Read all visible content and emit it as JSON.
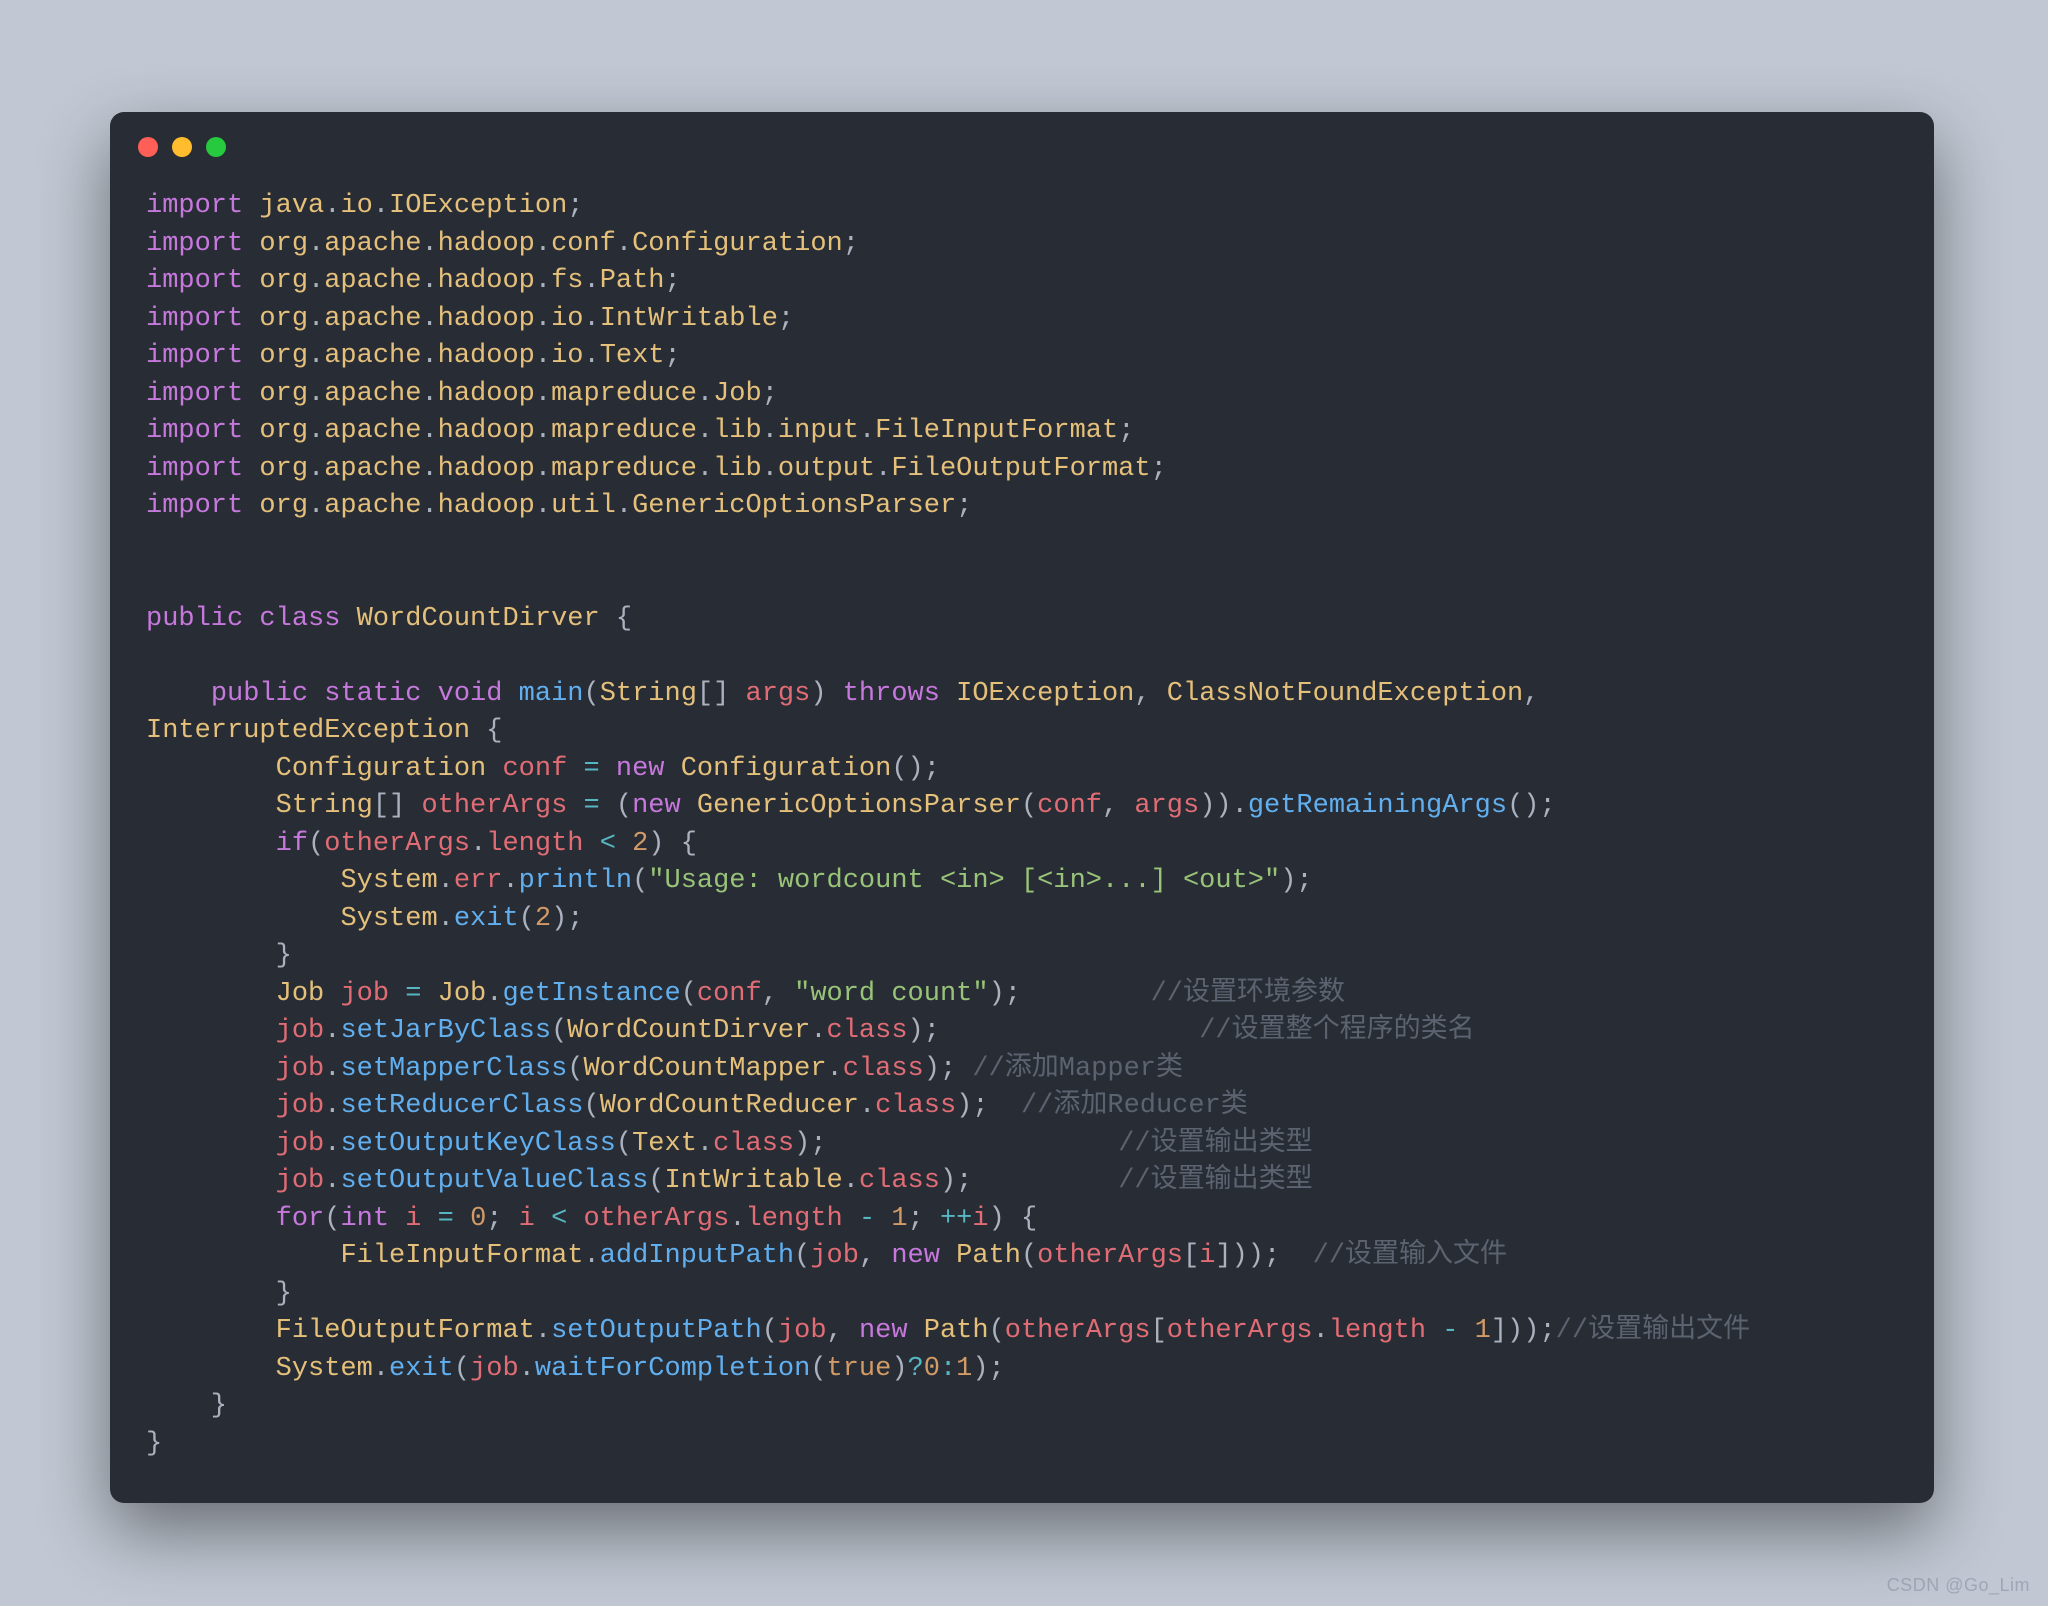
{
  "watermark": "CSDN @Go_Lim",
  "tokens": [
    {
      "c": "kw",
      "t": "import"
    },
    {
      "c": "pun",
      "t": " "
    },
    {
      "c": "pkg",
      "t": "java"
    },
    {
      "c": "pun",
      "t": "."
    },
    {
      "c": "pkg",
      "t": "io"
    },
    {
      "c": "pun",
      "t": "."
    },
    {
      "c": "pkg",
      "t": "IOException"
    },
    {
      "c": "pun",
      "t": ";"
    },
    {
      "nl": true
    },
    {
      "c": "kw",
      "t": "import"
    },
    {
      "c": "pun",
      "t": " "
    },
    {
      "c": "pkg",
      "t": "org"
    },
    {
      "c": "pun",
      "t": "."
    },
    {
      "c": "pkg",
      "t": "apache"
    },
    {
      "c": "pun",
      "t": "."
    },
    {
      "c": "pkg",
      "t": "hadoop"
    },
    {
      "c": "pun",
      "t": "."
    },
    {
      "c": "pkg",
      "t": "conf"
    },
    {
      "c": "pun",
      "t": "."
    },
    {
      "c": "pkg",
      "t": "Configuration"
    },
    {
      "c": "pun",
      "t": ";"
    },
    {
      "nl": true
    },
    {
      "c": "kw",
      "t": "import"
    },
    {
      "c": "pun",
      "t": " "
    },
    {
      "c": "pkg",
      "t": "org"
    },
    {
      "c": "pun",
      "t": "."
    },
    {
      "c": "pkg",
      "t": "apache"
    },
    {
      "c": "pun",
      "t": "."
    },
    {
      "c": "pkg",
      "t": "hadoop"
    },
    {
      "c": "pun",
      "t": "."
    },
    {
      "c": "pkg",
      "t": "fs"
    },
    {
      "c": "pun",
      "t": "."
    },
    {
      "c": "pkg",
      "t": "Path"
    },
    {
      "c": "pun",
      "t": ";"
    },
    {
      "nl": true
    },
    {
      "c": "kw",
      "t": "import"
    },
    {
      "c": "pun",
      "t": " "
    },
    {
      "c": "pkg",
      "t": "org"
    },
    {
      "c": "pun",
      "t": "."
    },
    {
      "c": "pkg",
      "t": "apache"
    },
    {
      "c": "pun",
      "t": "."
    },
    {
      "c": "pkg",
      "t": "hadoop"
    },
    {
      "c": "pun",
      "t": "."
    },
    {
      "c": "pkg",
      "t": "io"
    },
    {
      "c": "pun",
      "t": "."
    },
    {
      "c": "pkg",
      "t": "IntWritable"
    },
    {
      "c": "pun",
      "t": ";"
    },
    {
      "nl": true
    },
    {
      "c": "kw",
      "t": "import"
    },
    {
      "c": "pun",
      "t": " "
    },
    {
      "c": "pkg",
      "t": "org"
    },
    {
      "c": "pun",
      "t": "."
    },
    {
      "c": "pkg",
      "t": "apache"
    },
    {
      "c": "pun",
      "t": "."
    },
    {
      "c": "pkg",
      "t": "hadoop"
    },
    {
      "c": "pun",
      "t": "."
    },
    {
      "c": "pkg",
      "t": "io"
    },
    {
      "c": "pun",
      "t": "."
    },
    {
      "c": "pkg",
      "t": "Text"
    },
    {
      "c": "pun",
      "t": ";"
    },
    {
      "nl": true
    },
    {
      "c": "kw",
      "t": "import"
    },
    {
      "c": "pun",
      "t": " "
    },
    {
      "c": "pkg",
      "t": "org"
    },
    {
      "c": "pun",
      "t": "."
    },
    {
      "c": "pkg",
      "t": "apache"
    },
    {
      "c": "pun",
      "t": "."
    },
    {
      "c": "pkg",
      "t": "hadoop"
    },
    {
      "c": "pun",
      "t": "."
    },
    {
      "c": "pkg",
      "t": "mapreduce"
    },
    {
      "c": "pun",
      "t": "."
    },
    {
      "c": "pkg",
      "t": "Job"
    },
    {
      "c": "pun",
      "t": ";"
    },
    {
      "nl": true
    },
    {
      "c": "kw",
      "t": "import"
    },
    {
      "c": "pun",
      "t": " "
    },
    {
      "c": "pkg",
      "t": "org"
    },
    {
      "c": "pun",
      "t": "."
    },
    {
      "c": "pkg",
      "t": "apache"
    },
    {
      "c": "pun",
      "t": "."
    },
    {
      "c": "pkg",
      "t": "hadoop"
    },
    {
      "c": "pun",
      "t": "."
    },
    {
      "c": "pkg",
      "t": "mapreduce"
    },
    {
      "c": "pun",
      "t": "."
    },
    {
      "c": "pkg",
      "t": "lib"
    },
    {
      "c": "pun",
      "t": "."
    },
    {
      "c": "pkg",
      "t": "input"
    },
    {
      "c": "pun",
      "t": "."
    },
    {
      "c": "pkg",
      "t": "FileInputFormat"
    },
    {
      "c": "pun",
      "t": ";"
    },
    {
      "nl": true
    },
    {
      "c": "kw",
      "t": "import"
    },
    {
      "c": "pun",
      "t": " "
    },
    {
      "c": "pkg",
      "t": "org"
    },
    {
      "c": "pun",
      "t": "."
    },
    {
      "c": "pkg",
      "t": "apache"
    },
    {
      "c": "pun",
      "t": "."
    },
    {
      "c": "pkg",
      "t": "hadoop"
    },
    {
      "c": "pun",
      "t": "."
    },
    {
      "c": "pkg",
      "t": "mapreduce"
    },
    {
      "c": "pun",
      "t": "."
    },
    {
      "c": "pkg",
      "t": "lib"
    },
    {
      "c": "pun",
      "t": "."
    },
    {
      "c": "pkg",
      "t": "output"
    },
    {
      "c": "pun",
      "t": "."
    },
    {
      "c": "pkg",
      "t": "FileOutputFormat"
    },
    {
      "c": "pun",
      "t": ";"
    },
    {
      "nl": true
    },
    {
      "c": "kw",
      "t": "import"
    },
    {
      "c": "pun",
      "t": " "
    },
    {
      "c": "pkg",
      "t": "org"
    },
    {
      "c": "pun",
      "t": "."
    },
    {
      "c": "pkg",
      "t": "apache"
    },
    {
      "c": "pun",
      "t": "."
    },
    {
      "c": "pkg",
      "t": "hadoop"
    },
    {
      "c": "pun",
      "t": "."
    },
    {
      "c": "pkg",
      "t": "util"
    },
    {
      "c": "pun",
      "t": "."
    },
    {
      "c": "pkg",
      "t": "GenericOptionsParser"
    },
    {
      "c": "pun",
      "t": ";"
    },
    {
      "nl": true
    },
    {
      "nl": true
    },
    {
      "nl": true
    },
    {
      "c": "kw",
      "t": "public"
    },
    {
      "c": "pun",
      "t": " "
    },
    {
      "c": "kw",
      "t": "class"
    },
    {
      "c": "pun",
      "t": " "
    },
    {
      "c": "pkg",
      "t": "WordCountDirver"
    },
    {
      "c": "pun",
      "t": " {"
    },
    {
      "nl": true
    },
    {
      "nl": true
    },
    {
      "c": "pun",
      "t": "    "
    },
    {
      "c": "kw",
      "t": "public"
    },
    {
      "c": "pun",
      "t": " "
    },
    {
      "c": "kw",
      "t": "static"
    },
    {
      "c": "pun",
      "t": " "
    },
    {
      "c": "kw",
      "t": "void"
    },
    {
      "c": "pun",
      "t": " "
    },
    {
      "c": "mth",
      "t": "main"
    },
    {
      "c": "pun",
      "t": "("
    },
    {
      "c": "pkg",
      "t": "String"
    },
    {
      "c": "pun",
      "t": "[] "
    },
    {
      "c": "id",
      "t": "args"
    },
    {
      "c": "pun",
      "t": ") "
    },
    {
      "c": "kw",
      "t": "throws"
    },
    {
      "c": "pun",
      "t": " "
    },
    {
      "c": "pkg",
      "t": "IOException"
    },
    {
      "c": "pun",
      "t": ", "
    },
    {
      "c": "pkg",
      "t": "ClassNotFoundException"
    },
    {
      "c": "pun",
      "t": ", "
    },
    {
      "nl": true
    },
    {
      "c": "pkg",
      "t": "InterruptedException"
    },
    {
      "c": "pun",
      "t": " {"
    },
    {
      "nl": true
    },
    {
      "c": "pun",
      "t": "        "
    },
    {
      "c": "pkg",
      "t": "Configuration"
    },
    {
      "c": "pun",
      "t": " "
    },
    {
      "c": "id",
      "t": "conf"
    },
    {
      "c": "pun",
      "t": " "
    },
    {
      "c": "op",
      "t": "="
    },
    {
      "c": "pun",
      "t": " "
    },
    {
      "c": "kw",
      "t": "new"
    },
    {
      "c": "pun",
      "t": " "
    },
    {
      "c": "pkg",
      "t": "Configuration"
    },
    {
      "c": "pun",
      "t": "();"
    },
    {
      "nl": true
    },
    {
      "c": "pun",
      "t": "        "
    },
    {
      "c": "pkg",
      "t": "String"
    },
    {
      "c": "pun",
      "t": "[] "
    },
    {
      "c": "id",
      "t": "otherArgs"
    },
    {
      "c": "pun",
      "t": " "
    },
    {
      "c": "op",
      "t": "="
    },
    {
      "c": "pun",
      "t": " ("
    },
    {
      "c": "kw",
      "t": "new"
    },
    {
      "c": "pun",
      "t": " "
    },
    {
      "c": "pkg",
      "t": "GenericOptionsParser"
    },
    {
      "c": "pun",
      "t": "("
    },
    {
      "c": "id",
      "t": "conf"
    },
    {
      "c": "pun",
      "t": ", "
    },
    {
      "c": "id",
      "t": "args"
    },
    {
      "c": "pun",
      "t": "))."
    },
    {
      "c": "mth",
      "t": "getRemainingArgs"
    },
    {
      "c": "pun",
      "t": "();"
    },
    {
      "nl": true
    },
    {
      "c": "pun",
      "t": "        "
    },
    {
      "c": "kw",
      "t": "if"
    },
    {
      "c": "pun",
      "t": "("
    },
    {
      "c": "id",
      "t": "otherArgs"
    },
    {
      "c": "pun",
      "t": "."
    },
    {
      "c": "id",
      "t": "length"
    },
    {
      "c": "pun",
      "t": " "
    },
    {
      "c": "op",
      "t": "<"
    },
    {
      "c": "pun",
      "t": " "
    },
    {
      "c": "num",
      "t": "2"
    },
    {
      "c": "pun",
      "t": ") {"
    },
    {
      "nl": true
    },
    {
      "c": "pun",
      "t": "            "
    },
    {
      "c": "pkg",
      "t": "System"
    },
    {
      "c": "pun",
      "t": "."
    },
    {
      "c": "id",
      "t": "err"
    },
    {
      "c": "pun",
      "t": "."
    },
    {
      "c": "mth",
      "t": "println"
    },
    {
      "c": "pun",
      "t": "("
    },
    {
      "c": "str",
      "t": "\"Usage: wordcount <in> [<in>...] <out>\""
    },
    {
      "c": "pun",
      "t": ");"
    },
    {
      "nl": true
    },
    {
      "c": "pun",
      "t": "            "
    },
    {
      "c": "pkg",
      "t": "System"
    },
    {
      "c": "pun",
      "t": "."
    },
    {
      "c": "mth",
      "t": "exit"
    },
    {
      "c": "pun",
      "t": "("
    },
    {
      "c": "num",
      "t": "2"
    },
    {
      "c": "pun",
      "t": ");"
    },
    {
      "nl": true
    },
    {
      "c": "pun",
      "t": "        }"
    },
    {
      "nl": true
    },
    {
      "c": "pun",
      "t": "        "
    },
    {
      "c": "pkg",
      "t": "Job"
    },
    {
      "c": "pun",
      "t": " "
    },
    {
      "c": "id",
      "t": "job"
    },
    {
      "c": "pun",
      "t": " "
    },
    {
      "c": "op",
      "t": "="
    },
    {
      "c": "pun",
      "t": " "
    },
    {
      "c": "pkg",
      "t": "Job"
    },
    {
      "c": "pun",
      "t": "."
    },
    {
      "c": "mth",
      "t": "getInstance"
    },
    {
      "c": "pun",
      "t": "("
    },
    {
      "c": "id",
      "t": "conf"
    },
    {
      "c": "pun",
      "t": ", "
    },
    {
      "c": "str",
      "t": "\"word count\""
    },
    {
      "c": "pun",
      "t": ");        "
    },
    {
      "c": "cmt",
      "t": "//设置环境参数"
    },
    {
      "nl": true
    },
    {
      "c": "pun",
      "t": "        "
    },
    {
      "c": "id",
      "t": "job"
    },
    {
      "c": "pun",
      "t": "."
    },
    {
      "c": "mth",
      "t": "setJarByClass"
    },
    {
      "c": "pun",
      "t": "("
    },
    {
      "c": "pkg",
      "t": "WordCountDirver"
    },
    {
      "c": "pun",
      "t": "."
    },
    {
      "c": "id",
      "t": "class"
    },
    {
      "c": "pun",
      "t": ");                "
    },
    {
      "c": "cmt",
      "t": "//设置整个程序的类名"
    },
    {
      "nl": true
    },
    {
      "c": "pun",
      "t": "        "
    },
    {
      "c": "id",
      "t": "job"
    },
    {
      "c": "pun",
      "t": "."
    },
    {
      "c": "mth",
      "t": "setMapperClass"
    },
    {
      "c": "pun",
      "t": "("
    },
    {
      "c": "pkg",
      "t": "WordCountMapper"
    },
    {
      "c": "pun",
      "t": "."
    },
    {
      "c": "id",
      "t": "class"
    },
    {
      "c": "pun",
      "t": "); "
    },
    {
      "c": "cmt",
      "t": "//添加Mapper类"
    },
    {
      "nl": true
    },
    {
      "c": "pun",
      "t": "        "
    },
    {
      "c": "id",
      "t": "job"
    },
    {
      "c": "pun",
      "t": "."
    },
    {
      "c": "mth",
      "t": "setReducerClass"
    },
    {
      "c": "pun",
      "t": "("
    },
    {
      "c": "pkg",
      "t": "WordCountReducer"
    },
    {
      "c": "pun",
      "t": "."
    },
    {
      "c": "id",
      "t": "class"
    },
    {
      "c": "pun",
      "t": ");  "
    },
    {
      "c": "cmt",
      "t": "//添加Reducer类"
    },
    {
      "nl": true
    },
    {
      "c": "pun",
      "t": "        "
    },
    {
      "c": "id",
      "t": "job"
    },
    {
      "c": "pun",
      "t": "."
    },
    {
      "c": "mth",
      "t": "setOutputKeyClass"
    },
    {
      "c": "pun",
      "t": "("
    },
    {
      "c": "pkg",
      "t": "Text"
    },
    {
      "c": "pun",
      "t": "."
    },
    {
      "c": "id",
      "t": "class"
    },
    {
      "c": "pun",
      "t": ");                  "
    },
    {
      "c": "cmt",
      "t": "//设置输出类型"
    },
    {
      "nl": true
    },
    {
      "c": "pun",
      "t": "        "
    },
    {
      "c": "id",
      "t": "job"
    },
    {
      "c": "pun",
      "t": "."
    },
    {
      "c": "mth",
      "t": "setOutputValueClass"
    },
    {
      "c": "pun",
      "t": "("
    },
    {
      "c": "pkg",
      "t": "IntWritable"
    },
    {
      "c": "pun",
      "t": "."
    },
    {
      "c": "id",
      "t": "class"
    },
    {
      "c": "pun",
      "t": ");         "
    },
    {
      "c": "cmt",
      "t": "//设置输出类型"
    },
    {
      "nl": true
    },
    {
      "c": "pun",
      "t": "        "
    },
    {
      "c": "kw",
      "t": "for"
    },
    {
      "c": "pun",
      "t": "("
    },
    {
      "c": "kw",
      "t": "int"
    },
    {
      "c": "pun",
      "t": " "
    },
    {
      "c": "id",
      "t": "i"
    },
    {
      "c": "pun",
      "t": " "
    },
    {
      "c": "op",
      "t": "="
    },
    {
      "c": "pun",
      "t": " "
    },
    {
      "c": "num",
      "t": "0"
    },
    {
      "c": "pun",
      "t": "; "
    },
    {
      "c": "id",
      "t": "i"
    },
    {
      "c": "pun",
      "t": " "
    },
    {
      "c": "op",
      "t": "<"
    },
    {
      "c": "pun",
      "t": " "
    },
    {
      "c": "id",
      "t": "otherArgs"
    },
    {
      "c": "pun",
      "t": "."
    },
    {
      "c": "id",
      "t": "length"
    },
    {
      "c": "pun",
      "t": " "
    },
    {
      "c": "op",
      "t": "-"
    },
    {
      "c": "pun",
      "t": " "
    },
    {
      "c": "num",
      "t": "1"
    },
    {
      "c": "pun",
      "t": "; "
    },
    {
      "c": "op",
      "t": "++"
    },
    {
      "c": "id",
      "t": "i"
    },
    {
      "c": "pun",
      "t": ") {"
    },
    {
      "nl": true
    },
    {
      "c": "pun",
      "t": "            "
    },
    {
      "c": "pkg",
      "t": "FileInputFormat"
    },
    {
      "c": "pun",
      "t": "."
    },
    {
      "c": "mth",
      "t": "addInputPath"
    },
    {
      "c": "pun",
      "t": "("
    },
    {
      "c": "id",
      "t": "job"
    },
    {
      "c": "pun",
      "t": ", "
    },
    {
      "c": "kw",
      "t": "new"
    },
    {
      "c": "pun",
      "t": " "
    },
    {
      "c": "pkg",
      "t": "Path"
    },
    {
      "c": "pun",
      "t": "("
    },
    {
      "c": "id",
      "t": "otherArgs"
    },
    {
      "c": "pun",
      "t": "["
    },
    {
      "c": "id",
      "t": "i"
    },
    {
      "c": "pun",
      "t": "]));  "
    },
    {
      "c": "cmt",
      "t": "//设置输入文件"
    },
    {
      "nl": true
    },
    {
      "c": "pun",
      "t": "        }"
    },
    {
      "nl": true
    },
    {
      "c": "pun",
      "t": "        "
    },
    {
      "c": "pkg",
      "t": "FileOutputFormat"
    },
    {
      "c": "pun",
      "t": "."
    },
    {
      "c": "mth",
      "t": "setOutputPath"
    },
    {
      "c": "pun",
      "t": "("
    },
    {
      "c": "id",
      "t": "job"
    },
    {
      "c": "pun",
      "t": ", "
    },
    {
      "c": "kw",
      "t": "new"
    },
    {
      "c": "pun",
      "t": " "
    },
    {
      "c": "pkg",
      "t": "Path"
    },
    {
      "c": "pun",
      "t": "("
    },
    {
      "c": "id",
      "t": "otherArgs"
    },
    {
      "c": "pun",
      "t": "["
    },
    {
      "c": "id",
      "t": "otherArgs"
    },
    {
      "c": "pun",
      "t": "."
    },
    {
      "c": "id",
      "t": "length"
    },
    {
      "c": "pun",
      "t": " "
    },
    {
      "c": "op",
      "t": "-"
    },
    {
      "c": "pun",
      "t": " "
    },
    {
      "c": "num",
      "t": "1"
    },
    {
      "c": "pun",
      "t": "]));"
    },
    {
      "c": "cmt",
      "t": "//设置输出文件"
    },
    {
      "nl": true
    },
    {
      "c": "pun",
      "t": "        "
    },
    {
      "c": "pkg",
      "t": "System"
    },
    {
      "c": "pun",
      "t": "."
    },
    {
      "c": "mth",
      "t": "exit"
    },
    {
      "c": "pun",
      "t": "("
    },
    {
      "c": "id",
      "t": "job"
    },
    {
      "c": "pun",
      "t": "."
    },
    {
      "c": "mth",
      "t": "waitForCompletion"
    },
    {
      "c": "pun",
      "t": "("
    },
    {
      "c": "num",
      "t": "true"
    },
    {
      "c": "pun",
      "t": ")"
    },
    {
      "c": "op",
      "t": "?"
    },
    {
      "c": "num",
      "t": "0"
    },
    {
      "c": "op",
      "t": ":"
    },
    {
      "c": "num",
      "t": "1"
    },
    {
      "c": "pun",
      "t": ");"
    },
    {
      "nl": true
    },
    {
      "c": "pun",
      "t": "    }"
    },
    {
      "nl": true
    },
    {
      "c": "pun",
      "t": "}"
    }
  ]
}
